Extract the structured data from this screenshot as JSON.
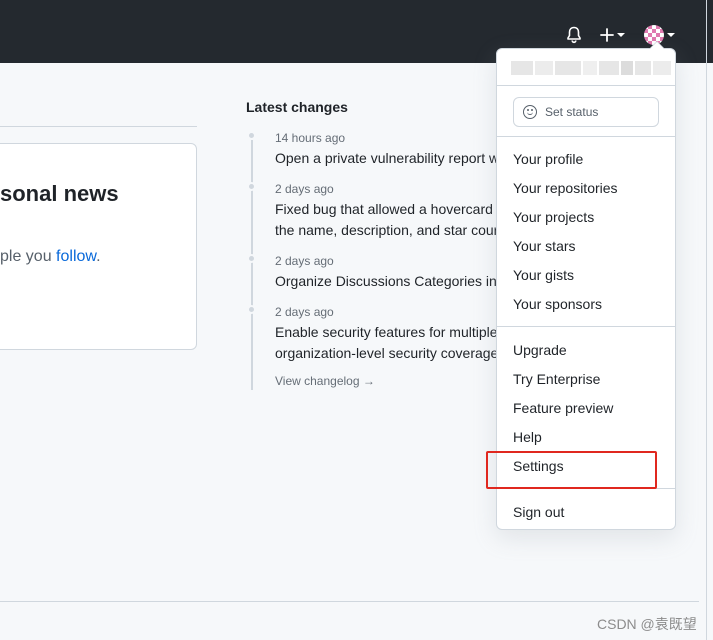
{
  "header": {
    "notifications_icon": "bell-icon",
    "create_icon": "plus-icon",
    "avatar_icon": "avatar"
  },
  "feed": {
    "title": "sonal news",
    "description_prefix": "ple you ",
    "follow_link": "follow",
    "description_suffix": "."
  },
  "latest_changes": {
    "title": "Latest changes",
    "items": [
      {
        "time": "14 hours ago",
        "text": "Open a private vulnerability report w"
      },
      {
        "time": "2 days ago",
        "text": "Fixed bug that allowed a hovercard",
        "text2": "the name, description, and star cour"
      },
      {
        "time": "2 days ago",
        "text": "Organize Discussions Categories into"
      },
      {
        "time": "2 days ago",
        "text": "Enable security features for multiple",
        "text2": "organization-level security coverage"
      }
    ],
    "view_changelog": "View changelog →"
  },
  "dropdown": {
    "set_status": "Set status",
    "items": [
      "Your profile",
      "Your repositories",
      "Your projects",
      "Your stars",
      "Your gists",
      "Your sponsors",
      "Upgrade",
      "Try Enterprise",
      "Feature preview",
      "Help",
      "Settings",
      "Sign out"
    ]
  },
  "watermark": "CSDN @袁既望",
  "colors": {
    "header_bg": "#24292f",
    "highlight": "#e0281f",
    "link": "#0969da"
  }
}
